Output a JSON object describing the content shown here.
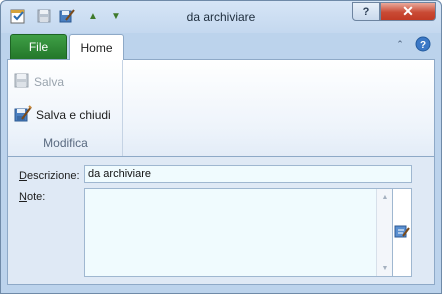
{
  "window": {
    "title": "da archiviare",
    "help_glyph": "?",
    "close_glyph": "✕"
  },
  "quick_access": {
    "icons": [
      "appointment-icon",
      "save-icon",
      "save-close-icon",
      "up-arrow-icon",
      "down-arrow-icon"
    ],
    "up_glyph": "▲",
    "down_glyph": "▼"
  },
  "ribbon": {
    "tabs": [
      {
        "label": "File",
        "color": "#2e8b34"
      },
      {
        "label": "Home",
        "selected": true
      }
    ],
    "collapse_glyph": "⌃",
    "group": {
      "label": "Modifica",
      "buttons": [
        {
          "label": "Salva",
          "enabled": false
        },
        {
          "label": "Salva e chiudi",
          "enabled": true
        }
      ]
    }
  },
  "form": {
    "description_label_underline": "D",
    "description_label_rest": "escrizione:",
    "description_value": "da archiviare",
    "notes_label_underline": "N",
    "notes_label_rest": "ote:",
    "notes_value": ""
  },
  "colors": {
    "accent": "#2e8b34",
    "close_button": "#c94a35",
    "input_background": "#f0fbfe"
  }
}
